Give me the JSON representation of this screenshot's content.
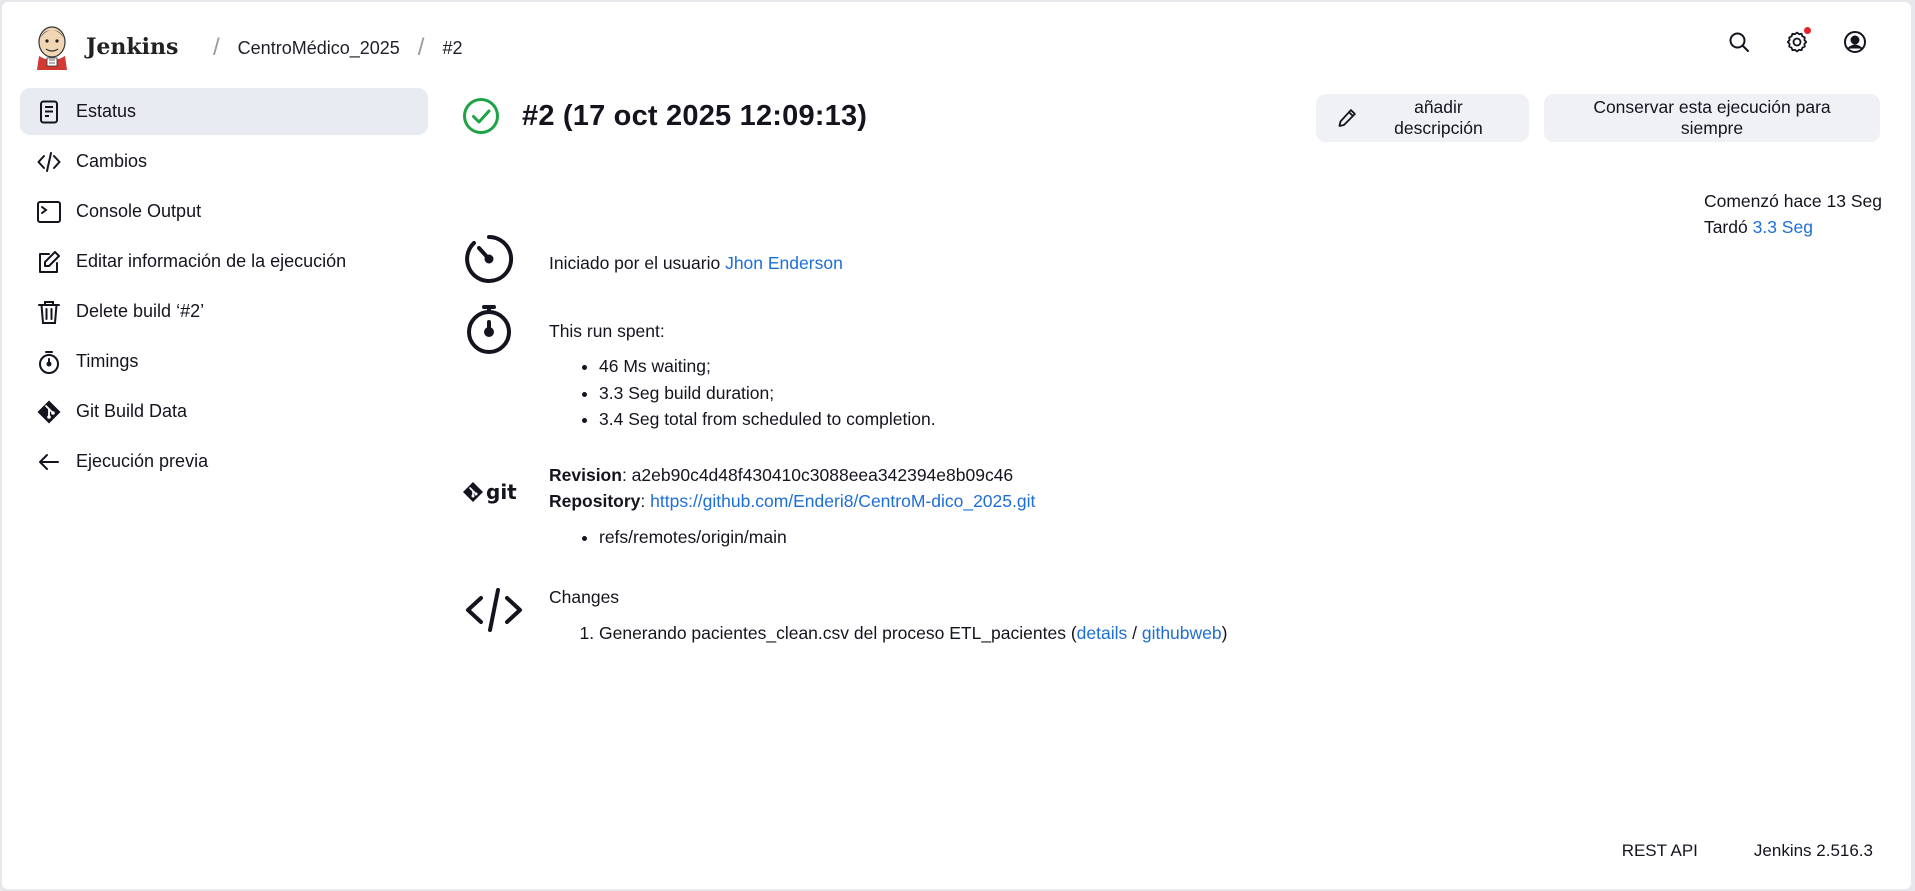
{
  "header": {
    "brand": "Jenkins",
    "breadcrumbs": [
      "CentroMédico_2025",
      "#2"
    ],
    "separator": "/"
  },
  "sidebar": {
    "items": [
      {
        "label": "Estatus",
        "icon": "document-icon",
        "active": true
      },
      {
        "label": "Cambios",
        "icon": "code-icon"
      },
      {
        "label": "Console Output",
        "icon": "terminal-icon"
      },
      {
        "label": "Editar información de la ejecución",
        "icon": "edit-icon"
      },
      {
        "label": "Delete build ‘#2’",
        "icon": "trash-icon"
      },
      {
        "label": "Timings",
        "icon": "stopwatch-icon"
      },
      {
        "label": "Git Build Data",
        "icon": "git-icon"
      },
      {
        "label": "Ejecución previa",
        "icon": "arrow-left-icon"
      }
    ]
  },
  "build": {
    "title": "#2 (17 oct 2025 12:09:13)",
    "status_color": "#1ea446",
    "add_description": "añadir descripción",
    "keep_forever": "Conservar esta ejecución para siempre"
  },
  "started": {
    "prefix": "Iniciado por el usuario ",
    "user": "Jhon Enderson"
  },
  "timing": {
    "started_ago": "Comenzó hace 13 Seg",
    "took_label": "Tardó ",
    "took_value": "3.3 Seg"
  },
  "spent": {
    "heading": "This run spent:",
    "items": [
      "46 Ms waiting;",
      "3.3 Seg build duration;",
      "3.4 Seg total from scheduled to completion."
    ]
  },
  "git": {
    "revision_label": "Revision",
    "revision": ": a2eb90c4d48f430410c3088eea342394e8b09c46",
    "repository_label": "Repository",
    "repository_sep": ": ",
    "repository_url": "https://github.com/Enderi8/CentroM-dico_2025.git",
    "refs": [
      "refs/remotes/origin/main"
    ]
  },
  "changes": {
    "heading": "Changes",
    "item_text": "Generando pacientes_clean.csv del proceso ETL_pacientes (",
    "details": "details",
    "slash": " / ",
    "githubweb": "githubweb",
    "close": ")"
  },
  "footer": {
    "rest_api": "REST API",
    "version": "Jenkins 2.516.3"
  },
  "colors": {
    "link": "#1e6ed8",
    "active_bg": "#e8ebf1",
    "notification": "#e5222a"
  }
}
